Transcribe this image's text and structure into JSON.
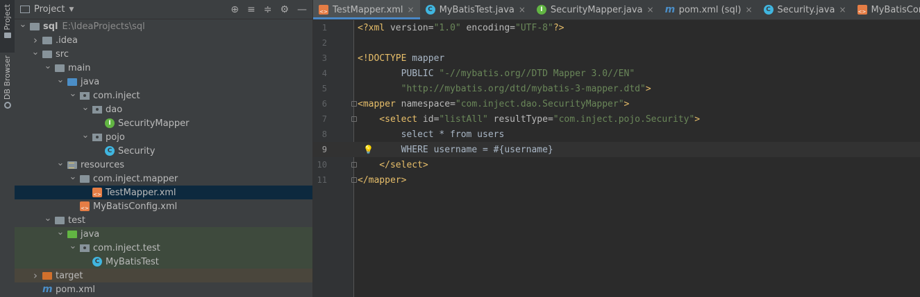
{
  "side_strip": {
    "project_tab": "Project",
    "db_tab": "DB Browser"
  },
  "project_panel": {
    "title": "Project",
    "tree": [
      {
        "label": "sql",
        "path": "E:\\IdeaProjects\\sql",
        "depth": 0,
        "arrow": "down",
        "icon": "folder",
        "bold": true
      },
      {
        "label": ".idea",
        "depth": 1,
        "arrow": "right",
        "icon": "folder"
      },
      {
        "label": "src",
        "depth": 1,
        "arrow": "down",
        "icon": "folder"
      },
      {
        "label": "main",
        "depth": 2,
        "arrow": "down",
        "icon": "folder"
      },
      {
        "label": "java",
        "depth": 3,
        "arrow": "down",
        "icon": "folder-blue"
      },
      {
        "label": "com.inject",
        "depth": 4,
        "arrow": "down",
        "icon": "package"
      },
      {
        "label": "dao",
        "depth": 5,
        "arrow": "down",
        "icon": "package"
      },
      {
        "label": "SecurityMapper",
        "depth": 6,
        "arrow": "none",
        "icon": "interface"
      },
      {
        "label": "pojo",
        "depth": 5,
        "arrow": "down",
        "icon": "package"
      },
      {
        "label": "Security",
        "depth": 6,
        "arrow": "none",
        "icon": "class"
      },
      {
        "label": "resources",
        "depth": 3,
        "arrow": "down",
        "icon": "folder-resources"
      },
      {
        "label": "com.inject.mapper",
        "depth": 4,
        "arrow": "down",
        "icon": "folder"
      },
      {
        "label": "TestMapper.xml",
        "depth": 5,
        "arrow": "none",
        "icon": "xml",
        "selected": true
      },
      {
        "label": "MyBatisConfig.xml",
        "depth": 4,
        "arrow": "none",
        "icon": "xml"
      },
      {
        "label": "test",
        "depth": 2,
        "arrow": "down",
        "icon": "folder"
      },
      {
        "label": "java",
        "depth": 3,
        "arrow": "down",
        "icon": "folder-green",
        "test": true
      },
      {
        "label": "com.inject.test",
        "depth": 4,
        "arrow": "down",
        "icon": "package",
        "test": true
      },
      {
        "label": "MyBatisTest",
        "depth": 5,
        "arrow": "none",
        "icon": "class",
        "test": true
      },
      {
        "label": "target",
        "depth": 1,
        "arrow": "right",
        "icon": "folder-orange",
        "excluded": true
      },
      {
        "label": "pom.xml",
        "depth": 1,
        "arrow": "none",
        "icon": "maven"
      }
    ]
  },
  "tabs": [
    {
      "label": "TestMapper.xml",
      "icon": "xml",
      "active": true
    },
    {
      "label": "MyBatisTest.java",
      "icon": "class"
    },
    {
      "label": "SecurityMapper.java",
      "icon": "interface"
    },
    {
      "label": "pom.xml (sql)",
      "icon": "maven"
    },
    {
      "label": "Security.java",
      "icon": "class"
    },
    {
      "label": "MyBatisConfig.xml",
      "icon": "xml"
    }
  ],
  "editor": {
    "current_line": 9,
    "lines": [
      {
        "n": "1",
        "parts": [
          [
            "tag",
            "<?xml "
          ],
          [
            "attr",
            "version="
          ],
          [
            "str",
            "\"1.0\""
          ],
          [
            "attr",
            " encoding="
          ],
          [
            "str",
            "\"UTF-8\""
          ],
          [
            "tag",
            "?>"
          ]
        ]
      },
      {
        "n": "2",
        "parts": []
      },
      {
        "n": "3",
        "parts": [
          [
            "tag",
            "<!DOCTYPE "
          ],
          [
            "txt",
            "mapper"
          ]
        ]
      },
      {
        "n": "4",
        "parts": [
          [
            "txt",
            "        PUBLIC "
          ],
          [
            "str",
            "\"-//mybatis.org//DTD Mapper 3.0//EN\""
          ]
        ]
      },
      {
        "n": "5",
        "parts": [
          [
            "str",
            "        \"http://mybatis.org/dtd/mybatis-3-mapper.dtd\""
          ],
          [
            "tag",
            ">"
          ]
        ]
      },
      {
        "n": "6",
        "parts": [
          [
            "tag",
            "<mapper "
          ],
          [
            "attr",
            "namespace="
          ],
          [
            "str",
            "\"com.inject.dao.SecurityMapper\""
          ],
          [
            "tag",
            ">"
          ]
        ],
        "fold": true
      },
      {
        "n": "7",
        "parts": [
          [
            "tag",
            "    <select "
          ],
          [
            "attr",
            "id="
          ],
          [
            "str",
            "\"listAll\""
          ],
          [
            "attr",
            " resultType="
          ],
          [
            "str",
            "\"com.inject.pojo.Security\""
          ],
          [
            "tag",
            ">"
          ]
        ],
        "fold": true
      },
      {
        "n": "8",
        "parts": [
          [
            "txt",
            "        select * from users"
          ]
        ]
      },
      {
        "n": "9",
        "parts": [
          [
            "txt",
            "        WHERE username = #{username}"
          ]
        ],
        "bulb": true
      },
      {
        "n": "10",
        "parts": [
          [
            "tag",
            "    </select>"
          ]
        ],
        "fold": true
      },
      {
        "n": "11",
        "parts": [
          [
            "tag",
            "</mapper>"
          ]
        ],
        "fold": true
      }
    ]
  }
}
